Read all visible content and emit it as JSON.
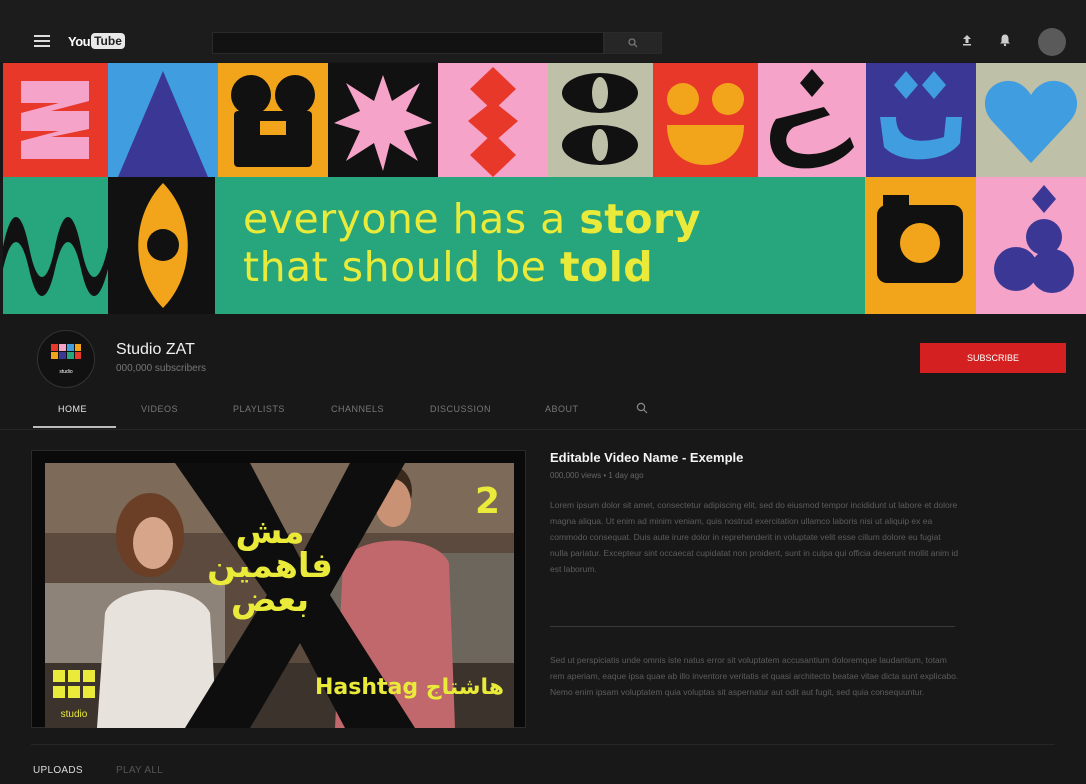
{
  "app": {
    "logo_you": "You",
    "logo_tube": "Tube"
  },
  "banner": {
    "line1_regular": "everyone has a ",
    "line1_bold": "story",
    "line2_regular": "that should be ",
    "line2_bold": "told"
  },
  "channel": {
    "name": "Studio ZAT",
    "subscribers": "000,000 subscribers",
    "subscribe_label": "SUBSCRIBE",
    "avatar_text": "studio"
  },
  "tabs": [
    {
      "label": "HOME"
    },
    {
      "label": "VIDEOS"
    },
    {
      "label": "PLAYLISTS"
    },
    {
      "label": "CHANNELS"
    },
    {
      "label": "DISCUSSION"
    },
    {
      "label": "ABOUT"
    }
  ],
  "featured": {
    "title": "Editable Video Name - Exemple",
    "meta": "000,000 views • 1 day ago",
    "description": "Lorem ipsum dolor sit amet, consectetur adipiscing elit, sed do eiusmod tempor incididunt ut labore et dolore magna aliqua. Ut enim ad minim veniam, quis nostrud exercitation ullamco laboris nisi ut aliquip ex ea commodo consequat. Duis aute irure dolor in reprehenderit in voluptate velit esse cillum dolore eu fugiat nulla pariatur. Excepteur sint occaecat cupidatat non proident, sunt in culpa qui officia deserunt mollit anim id est laborum.",
    "description2": "Sed ut perspiciatis unde omnis iste natus error sit voluptatem accusantium doloremque laudantium, totam rem aperiam, eaque ipsa quae ab illo inventore veritatis et quasi architecto beatae vitae dicta sunt explicabo. Nemo enim ipsam voluptatem quia voluptas sit aspernatur aut odit aut fugit, sed quia consequuntur.",
    "thumb_arabic": "مش فاهمين بعض",
    "thumb_number": "2",
    "thumb_hashtag": "Hashtag هاشتاج",
    "thumb_logo": "studio"
  },
  "sections": {
    "uploads_label": "UPLOADS",
    "playall_label": "PLAY ALL"
  },
  "colors": {
    "subscribe_red": "#d42020",
    "banner_yellow": "#e9ea3a",
    "banner_green": "#27a57c"
  }
}
